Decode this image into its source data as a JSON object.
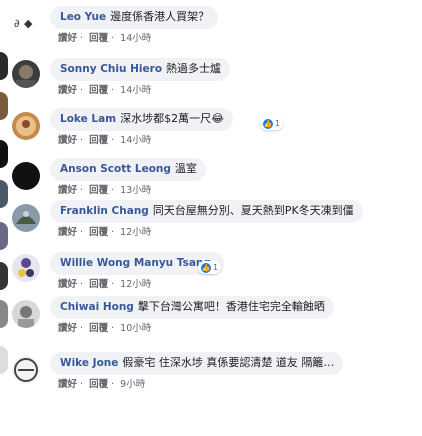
{
  "header": {
    "icon_label": "ᐊ"
  },
  "reaction_labels": {
    "count_1": "1"
  },
  "comments": [
    {
      "author": "Leo Yue",
      "text": "邊度係香港人買架？",
      "like": "讚好",
      "reply": "回覆",
      "time": "14小時"
    },
    {
      "author": "Sonny Chiu Hiero",
      "text": "熱過多士爐",
      "like": "讚好",
      "reply": "回覆",
      "time": "14小時"
    },
    {
      "author": "Loke Lam",
      "text": "深水埗都$2萬一尺😂",
      "like": "讚好",
      "reply": "回覆",
      "time": "14小時",
      "reaction_count": "1"
    },
    {
      "author": "Anson Scott Leong",
      "text": "溫室",
      "like": "讚好",
      "reply": "回覆",
      "time": "13小時"
    },
    {
      "author": "Franklin Chang",
      "text": "同天台屋無分別、夏天熱到PK冬天凍到僵",
      "like": "讚好",
      "reply": "回覆",
      "time": "12小時"
    },
    {
      "author": "Willie Wong Manyu Tsang",
      "text": "",
      "like": "讚好",
      "reply": "回覆",
      "time": "12小時",
      "reaction_count": "1"
    },
    {
      "author": "Chiwai Hong",
      "text": "擊下台灣公寓吧！香港住宅完全輸蝕晒",
      "like": "讚好",
      "reply": "回覆",
      "time": "10小時"
    },
    {
      "author": "Wike Jone",
      "text": "假豪宅 住深水埗 真係要認清楚 道友 隔籬…",
      "like": "讚好",
      "reply": "回覆",
      "time": "9小時"
    }
  ],
  "colors": {
    "link": "#385898",
    "bubble": "#f0f2f5",
    "meta": "#65676b",
    "like_blue": "#1877f2"
  }
}
